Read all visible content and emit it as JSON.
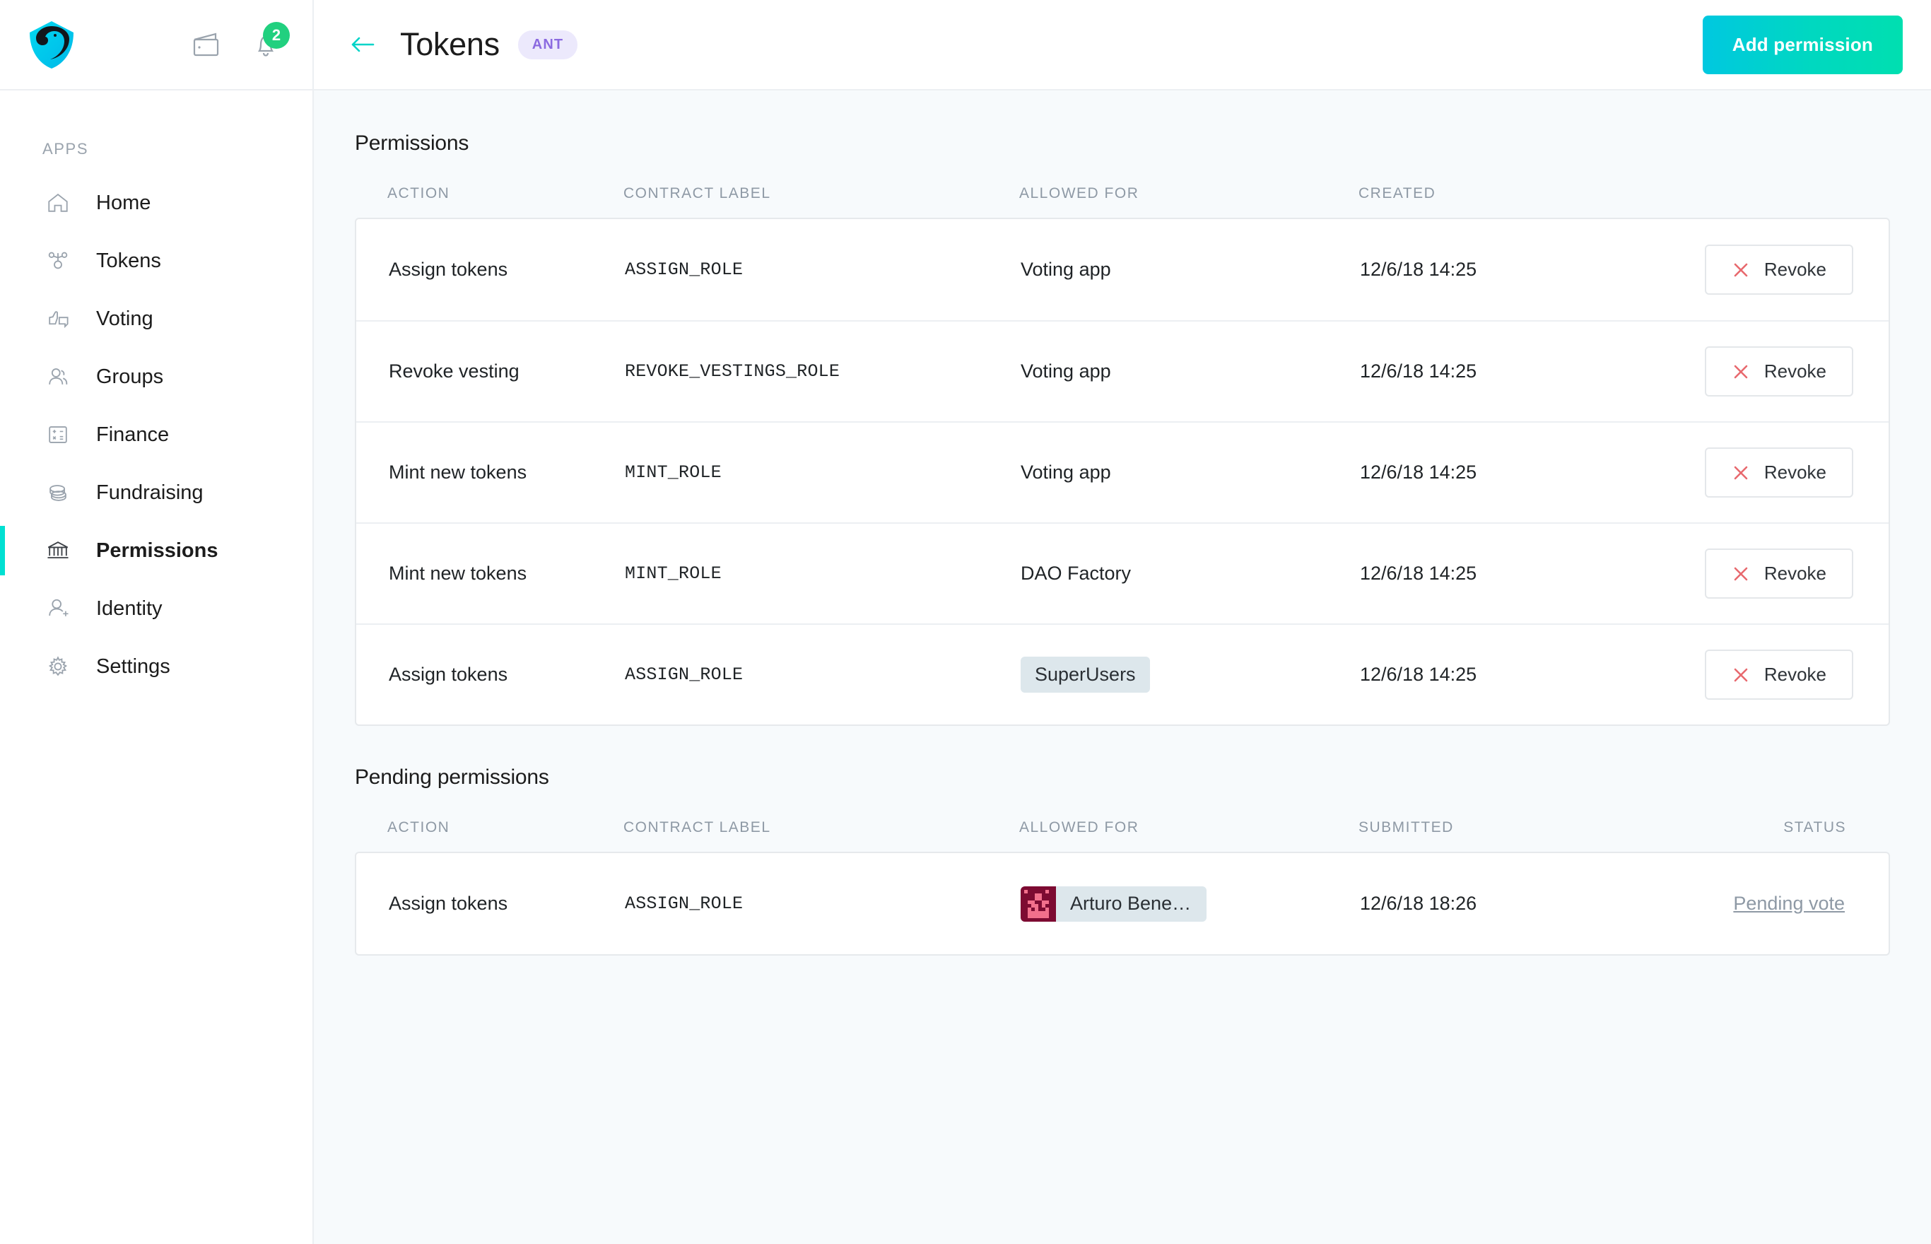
{
  "sidebar": {
    "section_label": "APPS",
    "items": [
      {
        "label": "Home",
        "icon": "home-icon",
        "active": false
      },
      {
        "label": "Tokens",
        "icon": "tokens-icon",
        "active": false
      },
      {
        "label": "Voting",
        "icon": "voting-icon",
        "active": false
      },
      {
        "label": "Groups",
        "icon": "groups-icon",
        "active": false
      },
      {
        "label": "Finance",
        "icon": "finance-icon",
        "active": false
      },
      {
        "label": "Fundraising",
        "icon": "fundraising-icon",
        "active": false
      },
      {
        "label": "Permissions",
        "icon": "permissions-icon",
        "active": true
      },
      {
        "label": "Identity",
        "icon": "identity-icon",
        "active": false
      },
      {
        "label": "Settings",
        "icon": "settings-icon",
        "active": false
      }
    ],
    "logo_icon": "aragon-shield-logo",
    "wallet_icon": "wallet-icon",
    "notifications_icon": "bell-icon",
    "notifications_count": "2"
  },
  "header": {
    "back_icon": "back-arrow-icon",
    "title": "Tokens",
    "badge": "ANT",
    "add_button": "Add permission"
  },
  "permissions": {
    "title": "Permissions",
    "columns": [
      "ACTION",
      "CONTRACT LABEL",
      "ALLOWED FOR",
      "CREATED"
    ],
    "rows": [
      {
        "action": "Assign tokens",
        "contract": "ASSIGN_ROLE",
        "allowed_for": "Voting app",
        "allowed_type": "text",
        "created": "12/6/18 14:25",
        "button": "Revoke"
      },
      {
        "action": "Revoke vesting",
        "contract": "REVOKE_VESTINGS_ROLE",
        "allowed_for": "Voting app",
        "allowed_type": "text",
        "created": "12/6/18 14:25",
        "button": "Revoke"
      },
      {
        "action": "Mint new tokens",
        "contract": "MINT_ROLE",
        "allowed_for": "Voting app",
        "allowed_type": "text",
        "created": "12/6/18 14:25",
        "button": "Revoke"
      },
      {
        "action": "Mint new tokens",
        "contract": "MINT_ROLE",
        "allowed_for": "DAO Factory",
        "allowed_type": "text",
        "created": "12/6/18 14:25",
        "button": "Revoke"
      },
      {
        "action": "Assign tokens",
        "contract": "ASSIGN_ROLE",
        "allowed_for": "SuperUsers",
        "allowed_type": "badge",
        "created": "12/6/18 14:25",
        "button": "Revoke"
      }
    ]
  },
  "pending_permissions": {
    "title": "Pending permissions",
    "columns": [
      "ACTION",
      "CONTRACT LABEL",
      "ALLOWED FOR",
      "SUBMITTED",
      "STATUS"
    ],
    "rows": [
      {
        "action": "Assign tokens",
        "contract": "ASSIGN_ROLE",
        "allowed_for": "Arturo Bene…",
        "allowed_type": "identity",
        "avatar_icon": "identicon-avatar",
        "submitted": "12/6/18 18:26",
        "status": "Pending vote"
      }
    ]
  },
  "colors": {
    "accent": "#00e0d2",
    "accent_button_start": "#00c8e0",
    "accent_button_end": "#00dfb0",
    "badge_purple_bg": "#ece9fc",
    "badge_purple_text": "#8b6ae0",
    "notification_green": "#21d07f",
    "revoke_red": "#e8696e",
    "content_bg": "#f7fafc",
    "group_badge_bg": "#dde7ec"
  }
}
